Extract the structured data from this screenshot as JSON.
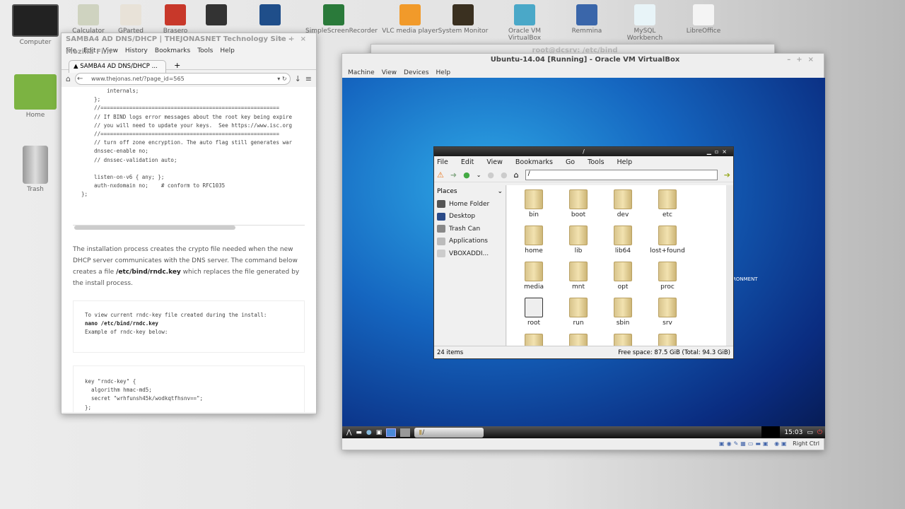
{
  "desktop": {
    "icons_top": [
      {
        "label": "Calculator",
        "color": "#cfd3c0"
      },
      {
        "label": "GParted",
        "color": "#e8e2d8"
      },
      {
        "label": "Brasero",
        "color": "#c8382a"
      },
      {
        "label": "",
        "color": "#333"
      },
      {
        "label": "",
        "color": "#1f4e8a"
      },
      {
        "label": "SimpleScreenRecorder",
        "color": "#2a7a3a"
      },
      {
        "label": "VLC media player",
        "color": "#f19a2a"
      },
      {
        "label": "System Monitor",
        "color": "#3a3020"
      },
      {
        "label": "Oracle VM VirtualBox",
        "color": "#4aa8c8"
      },
      {
        "label": "Remmina",
        "color": "#3a66aa"
      },
      {
        "label": "MySQL Workbench",
        "color": "#e8f4f8"
      },
      {
        "label": "LibreOffice",
        "color": "#f4f4f4"
      }
    ],
    "icons_left": [
      {
        "label": "Computer"
      },
      {
        "label": "Home"
      },
      {
        "label": "Trash"
      }
    ]
  },
  "firefox": {
    "title": "SAMBA4 AD DNS/DHCP | THEJONASNET Technology Site - Mozilla Fi...",
    "menu": [
      "File",
      "Edit",
      "View",
      "History",
      "Bookmarks",
      "Tools",
      "Help"
    ],
    "tab": "SAMBA4 AD DNS/DHCP ...",
    "url": "www.thejonas.net/?page_id=565",
    "code1": "        internals;\n    };\n    //========================================================\n    // If BIND logs error messages about the root key being expire\n    // you will need to update your keys.  See https://www.isc.org\n    //========================================================\n    // turn off zone encryption. The auto flag still generates war\n    dnssec-enable no;\n    // dnssec-validation auto;\n\n    listen-on-v6 { any; };\n    auth-nxdomain no;    # conform to RFC1035\n};",
    "para_a": "The installation process creates the crypto file needed when the new DHCP server communicates with the DNS server. The command below creates a file ",
    "para_bold": "/etc/bind/rndc.key",
    "para_b": " which replaces the file generated by the install process.",
    "code2": "To view current rndc-key file created during the install:",
    "code2_bold": "nano /etc/bind/rndc.key",
    "code2_end": "Example of rndc-key below:",
    "code3": "key \"rndc-key\" {\n  algorithm hmac-md5;\n  secret \"wrhfunsh45k/wodkqtfhsnv==\";\n};"
  },
  "terminal": {
    "title": "root@dcsrv: /etc/bind"
  },
  "vbox": {
    "title": "Ubuntu-14.04 [Running] - Oracle VM VirtualBox",
    "menu": [
      "Machine",
      "View",
      "Devices",
      "Help"
    ],
    "host_key": "Right Ctrl"
  },
  "guest": {
    "clock": "15:03",
    "task": "/",
    "wall_text": "RONMENT"
  },
  "fm": {
    "title": "/",
    "menu": [
      "File",
      "Edit",
      "View",
      "Bookmarks",
      "Go",
      "Tools",
      "Help"
    ],
    "path": "/",
    "places_label": "Places",
    "places": [
      "Home Folder",
      "Desktop",
      "Trash Can",
      "Applications",
      "VBOXADDI..."
    ],
    "items": [
      "bin",
      "boot",
      "dev",
      "etc",
      "home",
      "lib",
      "lib64",
      "lost+found",
      "media",
      "mnt",
      "opt",
      "proc",
      "root",
      "run",
      "sbin",
      "srv"
    ],
    "count": "24 items",
    "free": "Free space: 87.5 GiB (Total: 94.3 GiB)"
  }
}
